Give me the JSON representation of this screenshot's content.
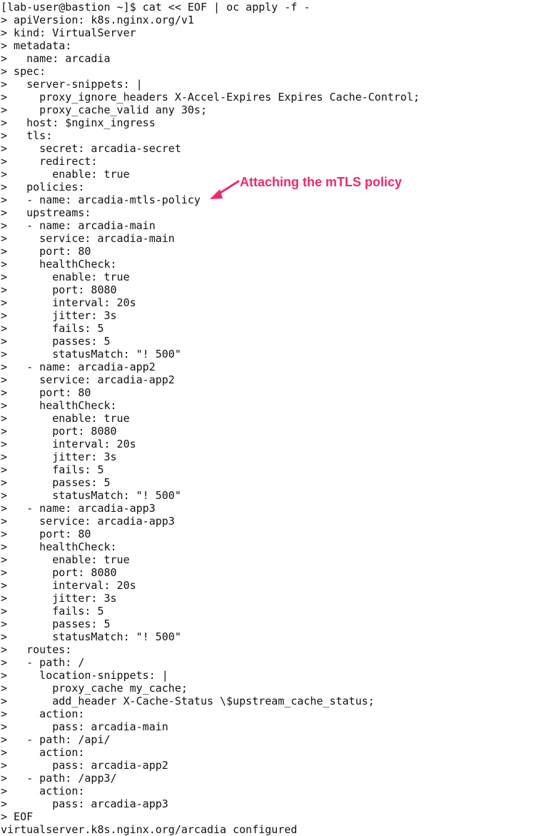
{
  "terminal": {
    "lines": [
      "[lab-user@bastion ~]$ cat << EOF | oc apply -f -",
      "> apiVersion: k8s.nginx.org/v1",
      "> kind: VirtualServer",
      "> metadata:",
      ">   name: arcadia",
      "> spec:",
      ">   server-snippets: |",
      ">     proxy_ignore_headers X-Accel-Expires Expires Cache-Control;",
      ">     proxy_cache_valid any 30s;",
      ">   host: $nginx_ingress",
      ">   tls:",
      ">     secret: arcadia-secret",
      ">     redirect:",
      ">       enable: true",
      ">   policies:",
      ">   - name: arcadia-mtls-policy",
      ">   upstreams:",
      ">   - name: arcadia-main",
      ">     service: arcadia-main",
      ">     port: 80",
      ">     healthCheck:",
      ">       enable: true",
      ">       port: 8080",
      ">       interval: 20s",
      ">       jitter: 3s",
      ">       fails: 5",
      ">       passes: 5",
      ">       statusMatch: \"! 500\"",
      ">   - name: arcadia-app2",
      ">     service: arcadia-app2",
      ">     port: 80",
      ">     healthCheck:",
      ">       enable: true",
      ">       port: 8080",
      ">       interval: 20s",
      ">       jitter: 3s",
      ">       fails: 5",
      ">       passes: 5",
      ">       statusMatch: \"! 500\"",
      ">   - name: arcadia-app3",
      ">     service: arcadia-app3",
      ">     port: 80",
      ">     healthCheck:",
      ">       enable: true",
      ">       port: 8080",
      ">       interval: 20s",
      ">       jitter: 3s",
      ">       fails: 5",
      ">       passes: 5",
      ">       statusMatch: \"! 500\"",
      ">   routes:",
      ">   - path: /",
      ">     location-snippets: |",
      ">       proxy_cache my_cache;",
      ">       add_header X-Cache-Status \\$upstream_cache_status;",
      ">     action:",
      ">       pass: arcadia-main",
      ">   - path: /api/",
      ">     action:",
      ">       pass: arcadia-app2",
      ">   - path: /app3/",
      ">     action:",
      ">       pass: arcadia-app3",
      "> EOF",
      "virtualserver.k8s.nginx.org/arcadia configured"
    ]
  },
  "annotation": {
    "text": "Attaching the mTLS policy",
    "color": "#f0286e"
  },
  "icons": {
    "arrow": "arrow-icon"
  }
}
